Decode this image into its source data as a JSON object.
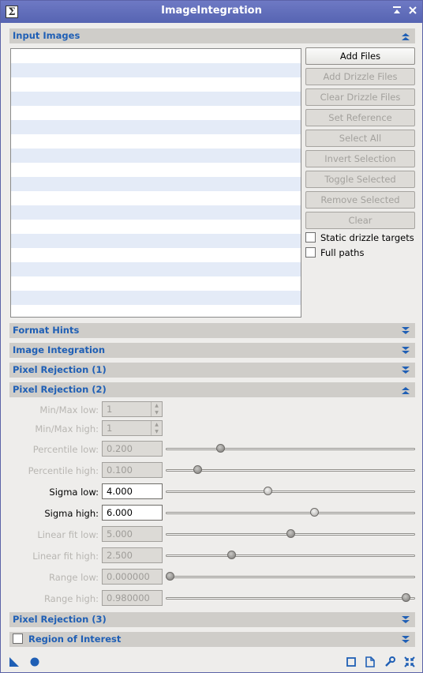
{
  "window": {
    "title": "ImageIntegration",
    "app_icon": "Σ",
    "shade_icon": "⏶",
    "close_icon": "✕"
  },
  "sections": {
    "input_images": "Input Images",
    "format_hints": "Format Hints",
    "image_integration": "Image Integration",
    "pixel_rejection_1": "Pixel Rejection (1)",
    "pixel_rejection_2": "Pixel Rejection (2)",
    "pixel_rejection_3": "Pixel Rejection (3)",
    "region_of_interest": "Region of Interest"
  },
  "buttons": {
    "add_files": "Add Files",
    "add_drizzle_files": "Add Drizzle Files",
    "clear_drizzle_files": "Clear Drizzle Files",
    "set_reference": "Set Reference",
    "select_all": "Select All",
    "invert_selection": "Invert Selection",
    "toggle_selected": "Toggle Selected",
    "remove_selected": "Remove Selected",
    "clear": "Clear"
  },
  "checkboxes": {
    "static_drizzle_targets": "Static drizzle targets",
    "full_paths": "Full paths"
  },
  "rejection2": {
    "minmax_low": {
      "label": "Min/Max low:",
      "value": "1"
    },
    "minmax_high": {
      "label": "Min/Max high:",
      "value": "1"
    },
    "percentile_low": {
      "label": "Percentile low:",
      "value": "0.200",
      "level": 0.21
    },
    "percentile_high": {
      "label": "Percentile high:",
      "value": "0.100",
      "level": 0.115
    },
    "sigma_low": {
      "label": "Sigma low:",
      "value": "4.000",
      "level": 0.405
    },
    "sigma_high": {
      "label": "Sigma high:",
      "value": "6.000",
      "level": 0.6
    },
    "linear_fit_low": {
      "label": "Linear fit low:",
      "value": "5.000",
      "level": 0.5
    },
    "linear_fit_high": {
      "label": "Linear fit high:",
      "value": "2.500",
      "level": 0.255
    },
    "range_low": {
      "label": "Range low:",
      "value": "0.000000",
      "level": 0.0
    },
    "range_high": {
      "label": "Range high:",
      "value": "0.980000",
      "level": 0.98
    }
  },
  "footer_icons": [
    "new-instance-icon",
    "apply-global-icon",
    "preview-icon",
    "save-icon",
    "settings-icon",
    "reset-icon"
  ]
}
